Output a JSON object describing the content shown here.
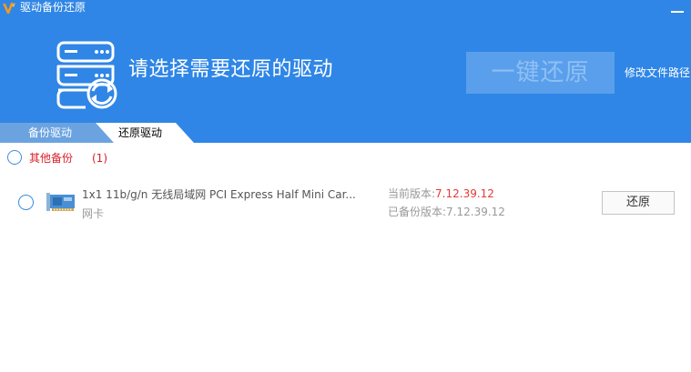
{
  "window": {
    "title": "驱动备份还原",
    "logo_icon": "orange-v-logo-icon",
    "minimize_icon": "minimize-icon"
  },
  "header": {
    "icon": "server-restore-icon",
    "headline": "请选择需要还原的驱动",
    "restore_all_label": "一键还原",
    "modify_path_label": "修改文件路径"
  },
  "tabs": [
    {
      "label": "备份驱动",
      "active": false
    },
    {
      "label": "还原驱动",
      "active": true
    }
  ],
  "group": {
    "label": "其他备份",
    "count": "(1)"
  },
  "drivers": [
    {
      "name": "1x1 11b/g/n 无线局域网 PCI Express Half Mini Car...",
      "category": "网卡",
      "icon": "network-card-icon",
      "current_version_label": "当前版本:",
      "current_version": "7.12.39.12",
      "backup_version_label": "已备份版本:",
      "backup_version": "7.12.39.12",
      "restore_label": "还原"
    }
  ],
  "colors": {
    "header_bg": "#2f86e6",
    "accent_red": "#d8202a",
    "version_red": "#e53935",
    "disabled_button_bg": "#5a9fec"
  }
}
